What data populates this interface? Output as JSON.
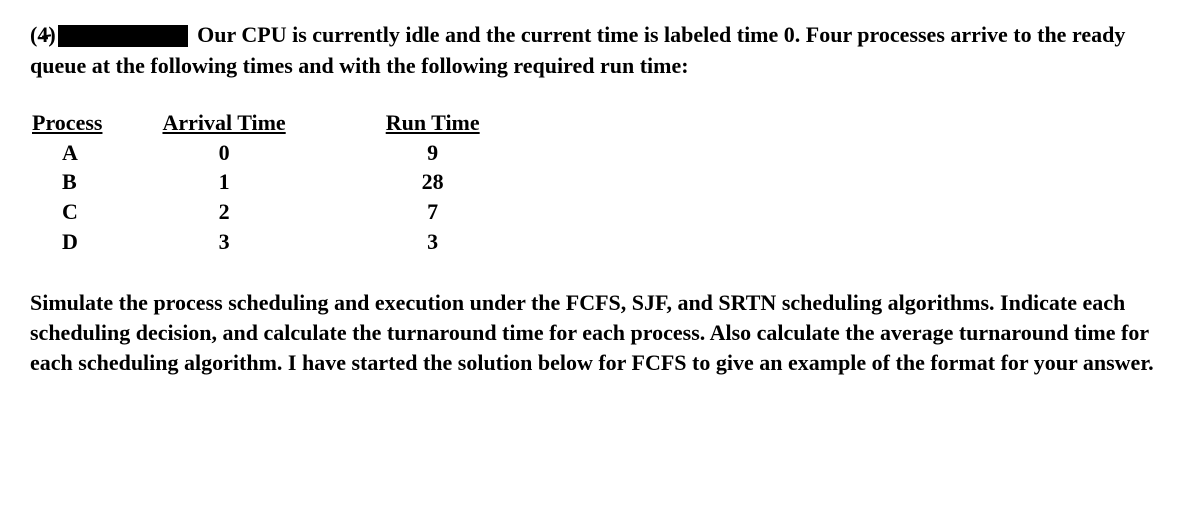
{
  "question_number": "(4)",
  "intro_text_part1": "Our CPU is currently idle and the current time is labeled time 0.  Four processes arrive to the ready queue at the following times and with the following required run time:",
  "headers": {
    "process": "Process",
    "arrival": "Arrival Time",
    "runtime": "Run Time"
  },
  "rows": [
    {
      "process": "A",
      "arrival": "0",
      "runtime": "9"
    },
    {
      "process": "B",
      "arrival": "1",
      "runtime": "28"
    },
    {
      "process": "C",
      "arrival": "2",
      "runtime": "7"
    },
    {
      "process": "D",
      "arrival": "3",
      "runtime": "3"
    }
  ],
  "instructions": "Simulate the process scheduling and execution under the FCFS, SJF, and SRTN scheduling algorithms.  Indicate each scheduling decision, and calculate the turnaround time for each process.  Also calculate the average turnaround time for each scheduling algorithm.  I have started the solution below for FCFS to give an example of the format for your answer."
}
